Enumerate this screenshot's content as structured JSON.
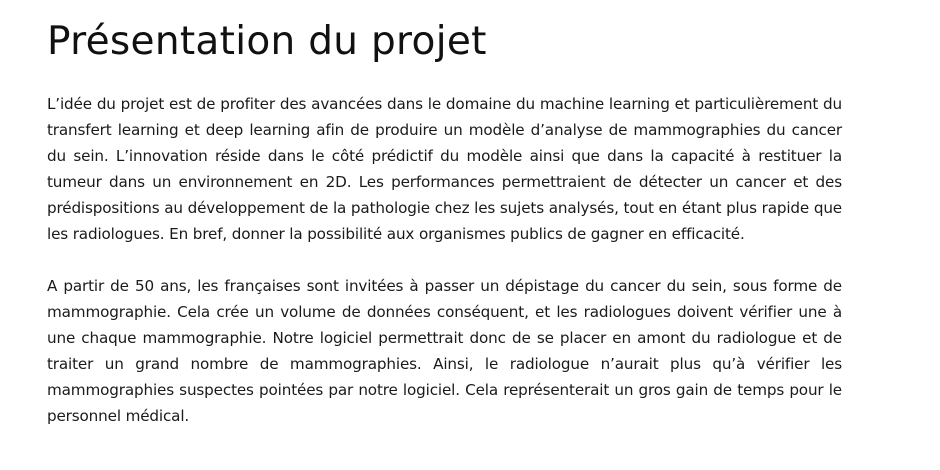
{
  "document": {
    "title": "Présentation du projet",
    "paragraphs": [
      "L’idée du projet est de profiter des avancées dans le domaine du machine learning et particulièrement du transfert learning et deep learning afin de produire un modèle d’analyse de mammographies du cancer du sein. L’innovation réside dans le côté prédictif du modèle ainsi que dans la capacité à restituer la tumeur dans un environnement en 2D. Les performances permettraient de détecter un cancer et des prédispositions au développement de la pathologie chez les sujets analysés, tout en étant plus rapide que les radiologues. En bref, donner la possibilité aux organismes publics de gagner en efficacité.",
      "A partir de 50 ans, les françaises sont invitées à passer un dépistage du cancer du sein, sous forme de mammographie. Cela crée un volume de données conséquent, et les radiologues doivent vérifier une à une chaque mammographie. Notre logiciel permettrait donc de se placer en amont du radiologue et de traiter un grand nombre de mammographies. Ainsi, le radiologue n’aurait plus qu’à vérifier les mammographies suspectes pointées par notre logiciel. Cela représenterait un gros gain de temps pour le personnel médical."
    ]
  }
}
